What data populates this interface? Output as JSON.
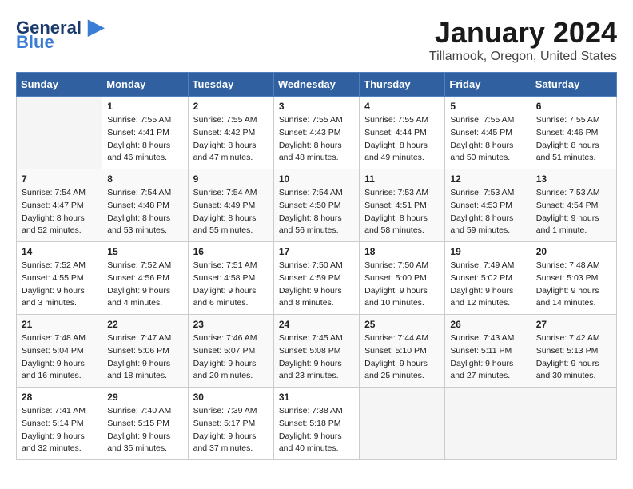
{
  "logo": {
    "line1": "General",
    "line2": "Blue"
  },
  "title": "January 2024",
  "location": "Tillamook, Oregon, United States",
  "days_of_week": [
    "Sunday",
    "Monday",
    "Tuesday",
    "Wednesday",
    "Thursday",
    "Friday",
    "Saturday"
  ],
  "weeks": [
    [
      {
        "day": "",
        "info": ""
      },
      {
        "day": "1",
        "info": "Sunrise: 7:55 AM\nSunset: 4:41 PM\nDaylight: 8 hours\nand 46 minutes."
      },
      {
        "day": "2",
        "info": "Sunrise: 7:55 AM\nSunset: 4:42 PM\nDaylight: 8 hours\nand 47 minutes."
      },
      {
        "day": "3",
        "info": "Sunrise: 7:55 AM\nSunset: 4:43 PM\nDaylight: 8 hours\nand 48 minutes."
      },
      {
        "day": "4",
        "info": "Sunrise: 7:55 AM\nSunset: 4:44 PM\nDaylight: 8 hours\nand 49 minutes."
      },
      {
        "day": "5",
        "info": "Sunrise: 7:55 AM\nSunset: 4:45 PM\nDaylight: 8 hours\nand 50 minutes."
      },
      {
        "day": "6",
        "info": "Sunrise: 7:55 AM\nSunset: 4:46 PM\nDaylight: 8 hours\nand 51 minutes."
      }
    ],
    [
      {
        "day": "7",
        "info": "Sunrise: 7:54 AM\nSunset: 4:47 PM\nDaylight: 8 hours\nand 52 minutes."
      },
      {
        "day": "8",
        "info": "Sunrise: 7:54 AM\nSunset: 4:48 PM\nDaylight: 8 hours\nand 53 minutes."
      },
      {
        "day": "9",
        "info": "Sunrise: 7:54 AM\nSunset: 4:49 PM\nDaylight: 8 hours\nand 55 minutes."
      },
      {
        "day": "10",
        "info": "Sunrise: 7:54 AM\nSunset: 4:50 PM\nDaylight: 8 hours\nand 56 minutes."
      },
      {
        "day": "11",
        "info": "Sunrise: 7:53 AM\nSunset: 4:51 PM\nDaylight: 8 hours\nand 58 minutes."
      },
      {
        "day": "12",
        "info": "Sunrise: 7:53 AM\nSunset: 4:53 PM\nDaylight: 8 hours\nand 59 minutes."
      },
      {
        "day": "13",
        "info": "Sunrise: 7:53 AM\nSunset: 4:54 PM\nDaylight: 9 hours\nand 1 minute."
      }
    ],
    [
      {
        "day": "14",
        "info": "Sunrise: 7:52 AM\nSunset: 4:55 PM\nDaylight: 9 hours\nand 3 minutes."
      },
      {
        "day": "15",
        "info": "Sunrise: 7:52 AM\nSunset: 4:56 PM\nDaylight: 9 hours\nand 4 minutes."
      },
      {
        "day": "16",
        "info": "Sunrise: 7:51 AM\nSunset: 4:58 PM\nDaylight: 9 hours\nand 6 minutes."
      },
      {
        "day": "17",
        "info": "Sunrise: 7:50 AM\nSunset: 4:59 PM\nDaylight: 9 hours\nand 8 minutes."
      },
      {
        "day": "18",
        "info": "Sunrise: 7:50 AM\nSunset: 5:00 PM\nDaylight: 9 hours\nand 10 minutes."
      },
      {
        "day": "19",
        "info": "Sunrise: 7:49 AM\nSunset: 5:02 PM\nDaylight: 9 hours\nand 12 minutes."
      },
      {
        "day": "20",
        "info": "Sunrise: 7:48 AM\nSunset: 5:03 PM\nDaylight: 9 hours\nand 14 minutes."
      }
    ],
    [
      {
        "day": "21",
        "info": "Sunrise: 7:48 AM\nSunset: 5:04 PM\nDaylight: 9 hours\nand 16 minutes."
      },
      {
        "day": "22",
        "info": "Sunrise: 7:47 AM\nSunset: 5:06 PM\nDaylight: 9 hours\nand 18 minutes."
      },
      {
        "day": "23",
        "info": "Sunrise: 7:46 AM\nSunset: 5:07 PM\nDaylight: 9 hours\nand 20 minutes."
      },
      {
        "day": "24",
        "info": "Sunrise: 7:45 AM\nSunset: 5:08 PM\nDaylight: 9 hours\nand 23 minutes."
      },
      {
        "day": "25",
        "info": "Sunrise: 7:44 AM\nSunset: 5:10 PM\nDaylight: 9 hours\nand 25 minutes."
      },
      {
        "day": "26",
        "info": "Sunrise: 7:43 AM\nSunset: 5:11 PM\nDaylight: 9 hours\nand 27 minutes."
      },
      {
        "day": "27",
        "info": "Sunrise: 7:42 AM\nSunset: 5:13 PM\nDaylight: 9 hours\nand 30 minutes."
      }
    ],
    [
      {
        "day": "28",
        "info": "Sunrise: 7:41 AM\nSunset: 5:14 PM\nDaylight: 9 hours\nand 32 minutes."
      },
      {
        "day": "29",
        "info": "Sunrise: 7:40 AM\nSunset: 5:15 PM\nDaylight: 9 hours\nand 35 minutes."
      },
      {
        "day": "30",
        "info": "Sunrise: 7:39 AM\nSunset: 5:17 PM\nDaylight: 9 hours\nand 37 minutes."
      },
      {
        "day": "31",
        "info": "Sunrise: 7:38 AM\nSunset: 5:18 PM\nDaylight: 9 hours\nand 40 minutes."
      },
      {
        "day": "",
        "info": ""
      },
      {
        "day": "",
        "info": ""
      },
      {
        "day": "",
        "info": ""
      }
    ]
  ]
}
